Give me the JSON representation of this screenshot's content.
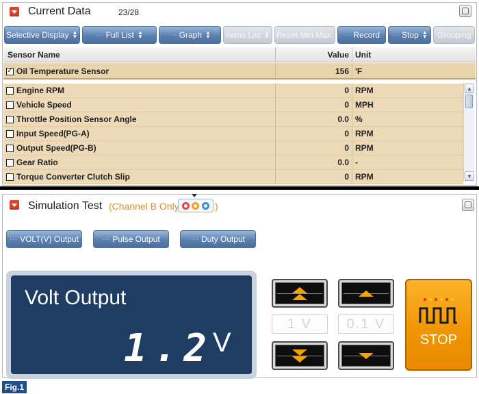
{
  "current_data": {
    "title": "Current Data",
    "counter": "23/28",
    "toolbar": [
      {
        "label": "Selective Display",
        "arrows": true,
        "disabled": false,
        "dots": false
      },
      {
        "label": "Full List",
        "arrows": true,
        "disabled": false,
        "dots": true
      },
      {
        "label": "Graph",
        "arrows": true,
        "disabled": false,
        "dots": true
      },
      {
        "label": "Items List",
        "arrows": true,
        "disabled": true,
        "dots": false
      },
      {
        "label": "Reset Min.Max.",
        "arrows": false,
        "disabled": true,
        "dots": false
      },
      {
        "label": "Record",
        "arrows": false,
        "disabled": false,
        "dots": true
      },
      {
        "label": "Stop",
        "arrows": true,
        "disabled": false,
        "dots": true
      },
      {
        "label": "Grouping",
        "arrows": false,
        "disabled": true,
        "dots": false
      }
    ],
    "columns": {
      "name": "Sensor Name",
      "value": "Value",
      "unit": "Unit"
    },
    "fixed_row": {
      "name": "Oil Temperature Sensor",
      "value": "156",
      "unit": "'F",
      "checked": true
    },
    "rows": [
      {
        "name": "Engine RPM",
        "value": "0",
        "unit": "RPM",
        "checked": false
      },
      {
        "name": "Vehicle Speed",
        "value": "0",
        "unit": "MPH",
        "checked": false
      },
      {
        "name": "Throttle Position Sensor Angle",
        "value": "0.0",
        "unit": "%",
        "checked": false
      },
      {
        "name": "Input Speed(PG-A)",
        "value": "0",
        "unit": "RPM",
        "checked": false
      },
      {
        "name": "Output Speed(PG-B)",
        "value": "0",
        "unit": "RPM",
        "checked": false
      },
      {
        "name": "Gear Ratio",
        "value": "0.0",
        "unit": "-",
        "checked": false
      },
      {
        "name": "Torque Converter Clutch Slip",
        "value": "0",
        "unit": "RPM",
        "checked": false
      }
    ]
  },
  "simulation": {
    "title": "Simulation Test",
    "channel_note": "(Channel B Only",
    "channel_note_close": ")",
    "channel_colors": [
      "#e04646",
      "#f0a020",
      "#2f8fe0"
    ],
    "output_buttons": [
      "VOLT(V) Output",
      "Pulse Output",
      "Duty Output"
    ],
    "display_label": "Volt Output",
    "display_value": "1.2",
    "display_unit": "V",
    "step_coarse": "1 V",
    "step_fine": "0.1 V",
    "stop_label": "STOP",
    "led_colors": [
      "#e03a2a",
      "#f6d21e",
      "#e03a2a",
      "#f6d21e",
      "#e03a2a",
      "#f6d21e"
    ]
  },
  "figure_label": "Fig.1",
  "colors": {
    "accent_orange": "#f09400",
    "toolbar_blue": "#5b80b0",
    "row_tan": "#ecd9b7",
    "display_navy": "#1f3c63"
  }
}
